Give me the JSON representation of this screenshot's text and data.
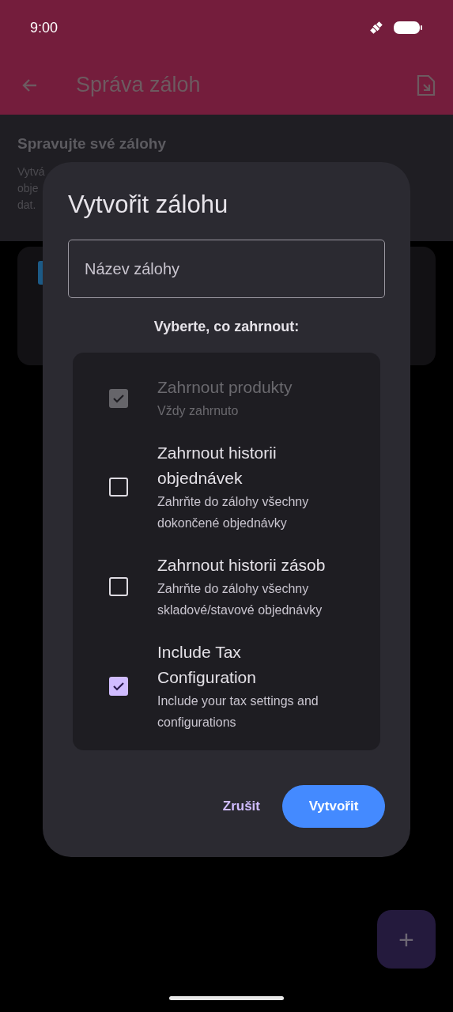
{
  "status_bar": {
    "time": "9:00"
  },
  "app_bar": {
    "title": "Správa záloh"
  },
  "header": {
    "title": "Spravujte své zálohy",
    "description_lines": [
      "Vytvá",
      "obje",
      "dat."
    ]
  },
  "dialog": {
    "title": "Vytvořit zálohu",
    "name_field": {
      "placeholder": "Název zálohy"
    },
    "section_label": "Vyberte, co zahrnout:",
    "options": [
      {
        "title": "Zahrnout produkty",
        "subtitle": "Vždy zahrnuto",
        "checked": true,
        "disabled": true
      },
      {
        "title": "Zahrnout historii objednávek",
        "subtitle": "Zahrňte do zálohy všechny dokončené objednávky",
        "checked": false,
        "disabled": false
      },
      {
        "title": "Zahrnout historii zásob",
        "subtitle": "Zahrňte do zálohy všechny skladové/stavové objednávky",
        "checked": false,
        "disabled": false
      },
      {
        "title": "Include Tax Configuration",
        "subtitle": "Include your tax settings and configurations",
        "checked": true,
        "disabled": false
      }
    ],
    "buttons": [
      {
        "label": "Zrušit",
        "kind": "text"
      },
      {
        "label": "Vytvořit",
        "kind": "filled"
      }
    ]
  },
  "fab": {
    "label": "+"
  }
}
